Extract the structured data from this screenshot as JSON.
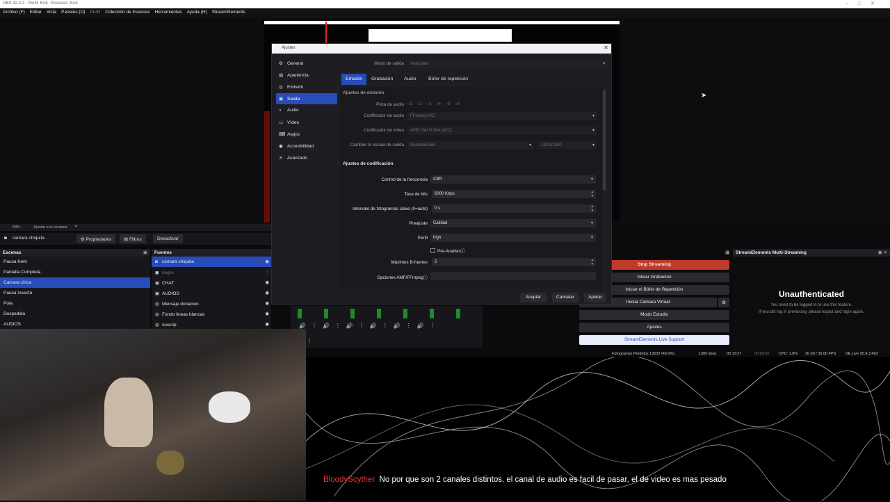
{
  "window": {
    "title": "OBS 32.0.2 - Perfil: Kick - Escenas: Kick"
  },
  "menu": [
    "Archivo (F)",
    "Editar",
    "Vista",
    "Paneles (D)",
    "Perfil",
    "Colección de Escenas",
    "Herramientas",
    "Ayuda (H)",
    "StreamElements"
  ],
  "preview_bar": {
    "zoom": "53%",
    "fit": "Ajustar a la ventana"
  },
  "toolbar": {
    "source": "camara chiquita",
    "props": "Propiedades",
    "filters": "Filtros",
    "deactivate": "Desactivar"
  },
  "scenes": {
    "title": "Escenas",
    "items": [
      "Pausa Kent",
      "Pantalla Completa",
      "Camara chica",
      "Pausa Insecto",
      "Poia",
      "Despedida",
      "AUDIOS"
    ]
  },
  "sources": {
    "title": "Fuentes",
    "items": [
      "camara chiquita",
      "negro",
      "CHAT",
      "AUDIOS",
      "Mensaje donacion",
      "Fondo lineas blancas",
      "suscrip"
    ]
  },
  "dialog": {
    "title": "Ajustes",
    "nav": [
      {
        "icon": "gear-icon",
        "label": "General"
      },
      {
        "icon": "paint-icon",
        "label": "Apariencia"
      },
      {
        "icon": "broadcast-icon",
        "label": "Emisión"
      },
      {
        "icon": "output-icon",
        "label": "Salida"
      },
      {
        "icon": "speaker-icon",
        "label": "Audio"
      },
      {
        "icon": "monitor-icon",
        "label": "Vídeo"
      },
      {
        "icon": "keyboard-icon",
        "label": "Atajos"
      },
      {
        "icon": "accessibility-icon",
        "label": "Accesibilidad"
      },
      {
        "icon": "wrench-icon",
        "label": "Avanzado"
      }
    ],
    "output_mode_label": "Modo de salida",
    "output_mode": "Avanzado",
    "tabs": [
      "Emisión",
      "Grabación",
      "Audio",
      "Búfer de repetición"
    ],
    "stream_settings": "Ajustes de emisión",
    "audio_track_label": "Pista de audio",
    "audio_tracks": [
      "1",
      "2",
      "3",
      "4",
      "5",
      "6"
    ],
    "audio_encoder_label": "Codificador de audio",
    "audio_encoder": "FFmpeg AAC",
    "video_encoder_label": "Codificador de vídeo",
    "video_encoder": "AMD HW H.264 (AVC)",
    "rescale_label": "Cambiar la escala de salida",
    "rescale": "Deshabilitado",
    "rescale_res": "1920x1080",
    "encoder_settings": "Ajustes de codificación",
    "rate_control_label": "Control de la frecuencia",
    "rate_control": "CBR",
    "bitrate_label": "Tasa de bits",
    "bitrate": "6000 Kbps",
    "keyframe_label": "Intervalo de fotogramas clave (0=auto)",
    "keyframe": "0 s",
    "preset_label": "Preajuste",
    "preset": "Calidad",
    "profile_label": "Perfil",
    "profile": "high",
    "preanalysis": "Pre-Analisis",
    "bframes_label": "Máximos B-frames",
    "bframes": "2",
    "amf_label": "Opciones AMF/FFmpeg",
    "accept": "Aceptar",
    "cancel": "Cancelar",
    "apply": "Aplicar"
  },
  "controls": [
    "Stop Streaming",
    "Iniciar Grabación",
    "Iniciar el Búfer de Repetición",
    "Iniciar Cámara Virtual",
    "Modo Estudio",
    "Ajustes",
    "StreamElements Live Support"
  ],
  "se_panel": {
    "title": "StreamElements Multi-Streaming",
    "heading": "Unauthenticated",
    "line1": "You need to be logged in to use this feature.",
    "line2": "If you did log in previously, please logout and login again."
  },
  "status": {
    "dropped": "Fotogramas Perdidos 13632 (49.0%)",
    "kbps": "1305 kbps",
    "live_time": "00:19:27",
    "rec_time": "00:00:00",
    "cpu": "CPU: 1.8%",
    "fps": "30.00 / 30.00 FPS",
    "version": "SE.Live 25.9.3.493"
  },
  "chat": {
    "user": "BloodyScyther",
    "message": "No por que son 2 canales distintos, el canal de audio es facil de pasar, el de video es mas pesado"
  },
  "colors": {
    "accent": "#284cb8",
    "stop": "#c0392b",
    "chat_user": "#e03a3a"
  }
}
